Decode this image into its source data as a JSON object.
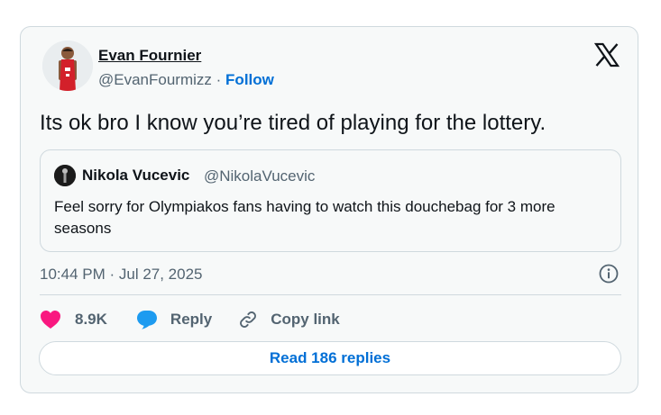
{
  "tweet": {
    "author": {
      "name": "Evan Fournier",
      "handle": "@EvanFourmizz",
      "separator": "·",
      "follow_label": "Follow"
    },
    "text": "Its ok bro I know you’re tired of playing for the lottery.",
    "quoted": {
      "name": "Nikola Vucevic",
      "handle": "@NikolaVucevic",
      "text": "Feel sorry for Olympiakos fans having to watch this douchebag for 3 more seasons"
    },
    "timestamp": "10:44 PM · Jul 27, 2025",
    "actions": {
      "like_count": "8.9K",
      "reply_label": "Reply",
      "copy_link_label": "Copy link"
    },
    "read_replies_label": "Read 186 replies"
  },
  "icons": {
    "logo": "x-logo-icon",
    "info": "info-icon",
    "like": "heart-icon",
    "reply": "speech-bubble-icon",
    "copy": "link-icon"
  },
  "colors": {
    "card_background": "#f7f9f9",
    "border": "#cfd9de",
    "link_blue": "#006fd6",
    "like_pink": "#f91880",
    "reply_blue": "#1d9bf0",
    "secondary_text": "#536471",
    "primary_text": "#0f1419"
  }
}
